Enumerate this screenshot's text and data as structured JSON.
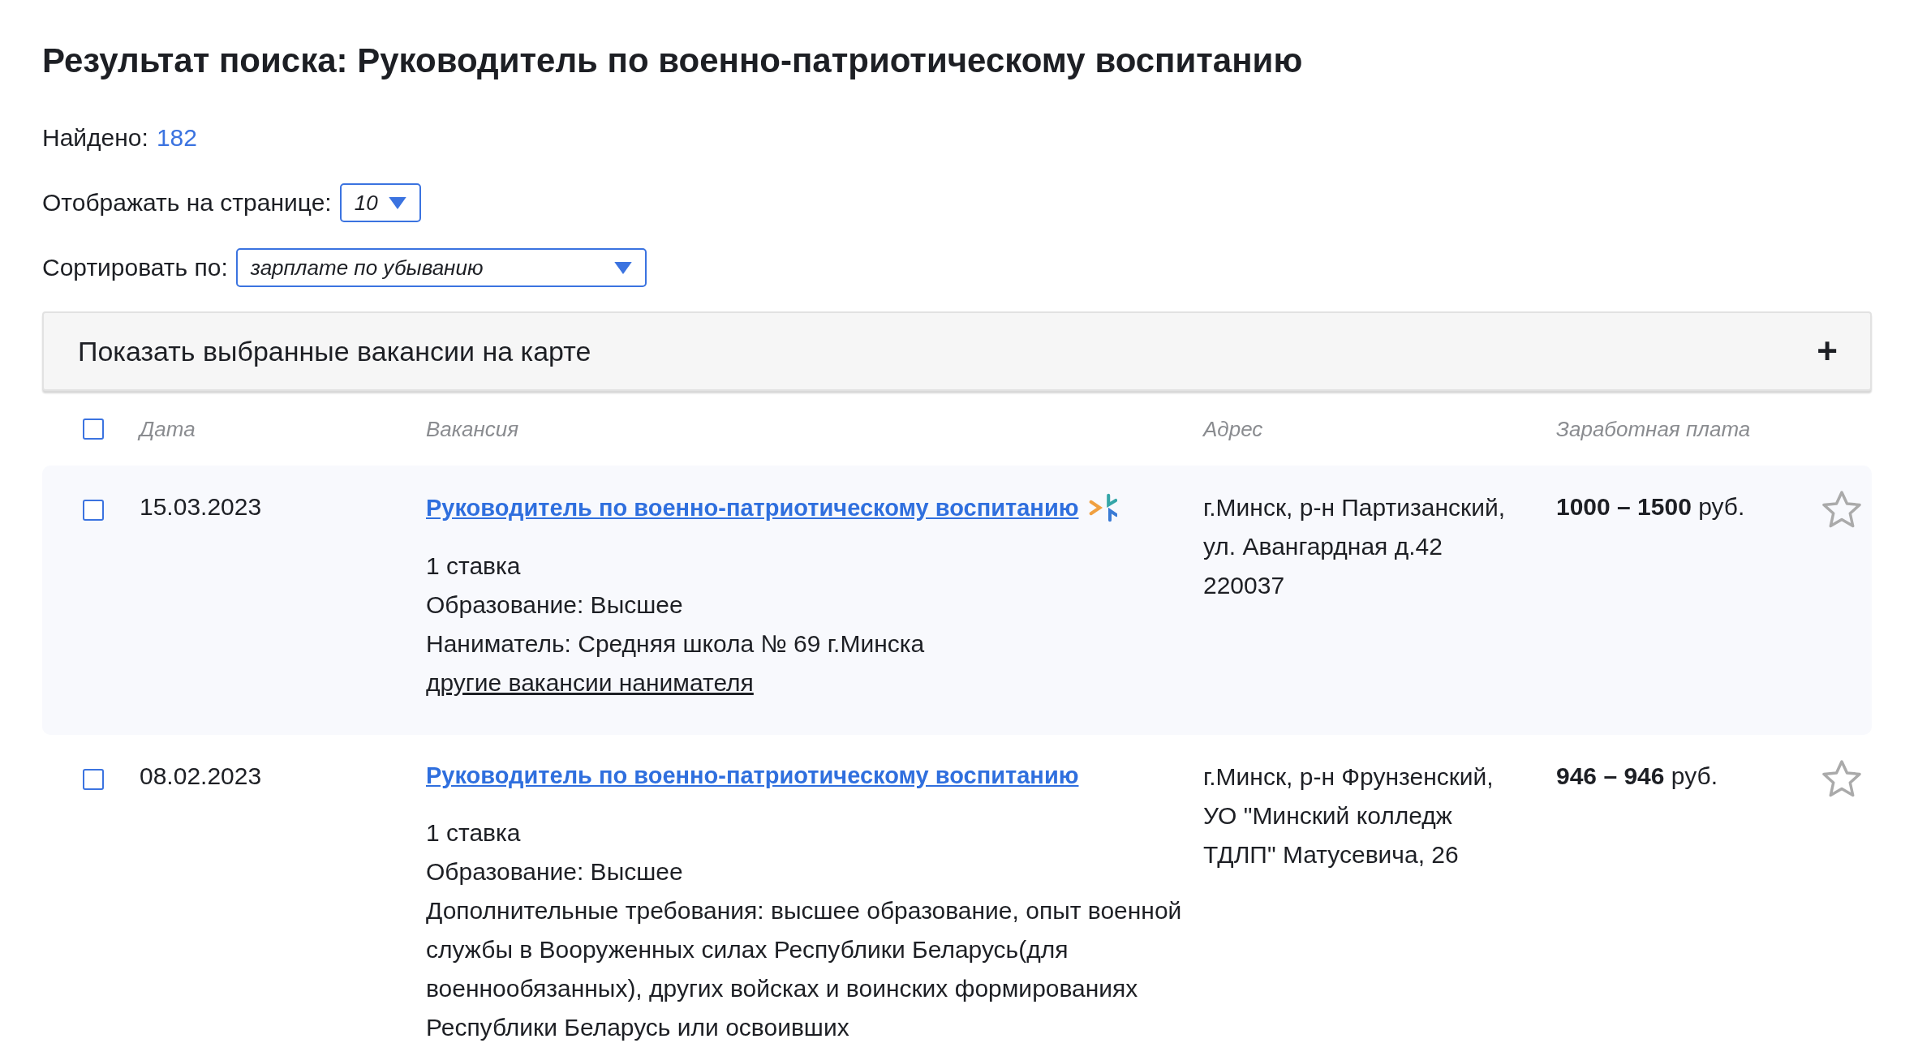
{
  "title": "Результат поиска: Руководитель по военно-патриотическому воспитанию",
  "found": {
    "label": "Найдено:",
    "count": "182"
  },
  "per_page": {
    "label": "Отображать на странице:",
    "value": "10"
  },
  "sort": {
    "label": "Сортировать по:",
    "value": "зарплате по убыванию"
  },
  "map_panel": {
    "label": "Показать выбранные вакансии на карте",
    "toggle": "+"
  },
  "table": {
    "select_all_checked": false,
    "columns": [
      "Дата",
      "Вакансия",
      "Адрес",
      "Заработная плата"
    ],
    "rows": [
      {
        "checked": false,
        "highlighted": true,
        "date": "15.03.2023",
        "title": "Руководитель по военно-патриотическому воспитанию",
        "badge": true,
        "details": [
          "1 ставка",
          "Образование: Высшее",
          "Наниматель: Средняя школа № 69 г.Минска"
        ],
        "employer_link": "другие вакансии нанимателя",
        "address": "г.Минск, р-н Партизанский, ул. Авангардная д.42 220037",
        "salary": "**1000 – 1500** руб.",
        "favorite": false
      },
      {
        "checked": false,
        "highlighted": false,
        "date": "08.02.2023",
        "title": "Руководитель по военно-патриотическому воспитанию",
        "badge": false,
        "details": [
          "1 ставка",
          "Образование: Высшее",
          "Дополнительные требования: высшее образование, опыт военной службы в Вооруженных силах Республики Беларусь(для военнообязанных), других войсках и воинских формированиях Республики Беларусь или освоивших"
        ],
        "address": "г.Минск, р-н Фрунзенский, УО \"Минский колледж ТДЛП\" Матусевича, 26",
        "salary": "**946 – 946** руб.",
        "favorite": false
      }
    ]
  }
}
